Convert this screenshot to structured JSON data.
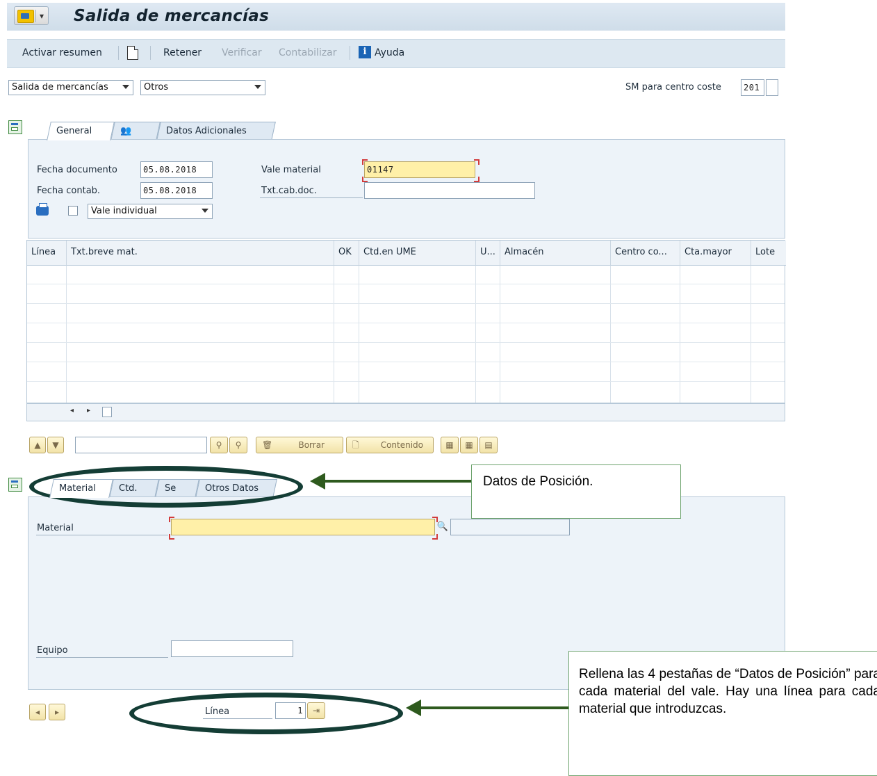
{
  "window": {
    "title": "Salida de mercancías"
  },
  "toolbar": {
    "activar_resumen": "Activar resumen",
    "retener": "Retener",
    "verificar": "Verificar",
    "contabilizar": "Contabilizar",
    "ayuda": "Ayuda"
  },
  "header": {
    "transaction_select": "Salida de mercancías",
    "reference_select": "Otros",
    "movement_label": "SM para centro coste",
    "movement_value": "201"
  },
  "doc_tabs": [
    "General",
    "",
    "Datos Adicionales"
  ],
  "general": {
    "fecha_documento_label": "Fecha documento",
    "fecha_documento_value": "05.08.2018",
    "fecha_contab_label": "Fecha contab.",
    "fecha_contab_value": "05.08.2018",
    "vale_material_label": "Vale material",
    "vale_material_value": "01147",
    "txt_cab_label": "Txt.cab.doc.",
    "txt_cab_value": "",
    "print_select": "Vale individual"
  },
  "items_table": {
    "columns": [
      "Línea",
      "Txt.breve mat.",
      "OK",
      "Ctd.en UME",
      "U...",
      "Almacén",
      "Centro co...",
      "Cta.mayor",
      "Lote"
    ],
    "rows": []
  },
  "item_toolbar": {
    "borrar": "Borrar",
    "contenido": "Contenido"
  },
  "item_tabs": [
    "Material",
    "Ctd.",
    "Se",
    "Otros Datos"
  ],
  "item_detail": {
    "material_label": "Material",
    "material_value": "",
    "equipo_label": "Equipo",
    "equipo_value": ""
  },
  "footer": {
    "linea_label": "Línea",
    "linea_value": "1"
  },
  "annotations": {
    "datos_posicion": "Datos de Posición.",
    "rellena": "Rellena las 4 pestañas de “Datos de Posición” para cada material del vale. Hay una línea para cada material que introduzcas."
  },
  "colors": {
    "annotation_ellipse": "#143d35",
    "annotation_arrow": "#2e5a1e",
    "required_field": "#fff0a8"
  }
}
